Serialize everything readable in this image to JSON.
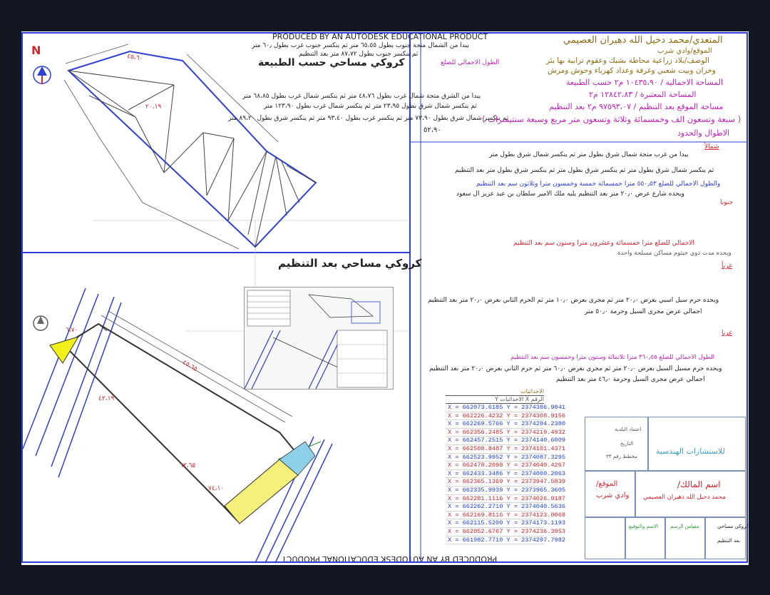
{
  "watermark": {
    "top": "PRODUCED BY AN AUTODESK EDUCATIONAL PRODUCT",
    "bottom": "PRODUCED BY AN AUTODESK EDUCATIONAL PRODUCT"
  },
  "north": {
    "label": "N"
  },
  "plan_top": {
    "title": "كروكي مساحي حسب الطبيعة",
    "north_dims": [
      "يبدا من الشمال متجة جنوب بطول ٦٥،٥٥ متر ثم ينكسر جنوب غرب بطول ٦٠٫ متر",
      "ثم ينكسر جنوب بطول ٨٧،٧٢ متر بعد التنظيم",
      "الطول الاجمالي للضلع"
    ],
    "east_dims": [
      "يبدا من الشرق متجة شمال غرب بطول ٤٨،٧٦ متر ثم ينكسر شمال غرب بطول ٦٨،٨٥ متر",
      "ثم ينكسر شمال شرق بطول ٢٣،٩٥ متر ثم ينكسر شمال غرب بطول ١٢٣،٩٠ متر",
      "ثم ينكسر شمال شرق بطول ٧٣،٩٠ متر ثم ينكسر غرب بطول ٩٣،٤٠ متر ثم ينكسر شرق بطول ٨٩،٢٠ متر"
    ],
    "dim_last": "٥٢،٩٠",
    "edge_labels": [
      "٤٥،٦٠",
      "٢٠،١٩"
    ]
  },
  "plan_bottom": {
    "title": "كروكي مساحي بعد التنظيم",
    "labels": [
      "٦،٧٠",
      "٤٥،٦٥",
      "٦٢،٦٥",
      "٧٤،١٠",
      "٤٢،١٩"
    ]
  },
  "right_panel": {
    "owner": "المتعدي/محمد دخيل الله دهيران العصيمي",
    "site": "الموقع/وادي شرب",
    "desc": "الوصف/بلاد زراعية محاطة بشبك وعقوم ترابية بها بئر",
    "desc2": "وخزان وبيت شعبي وغرفة وعداد كهرباء وحوش ومرش",
    "area_total": "المساحة الاجمالية / ١٠٤٣٥،٩٠ م٢ حسب الطبيعة",
    "area_after": "المساحة المعتبرة / ١٢٨٤٢،٨٣ م٢",
    "area_site": "مساحة الموقع بعد التنظيم / ٩٧٥٩٣،٠٧ م٢ بعد التنظيم",
    "area_words": "( سبعة وتسعون الف وخمسمائة وثلاثة وتسعون متر مربع وسبعة سنتيمترات )",
    "lengths_heading": "الاطوال والحدود",
    "north_h": "شمالاً",
    "north_l1": "يبدا من غرب متجة شمال شرق بطول متر ثم ينكسر شمال شرق بطول متر",
    "north_l2": "ثم ينكسر شمال شرق بطول متر ثم ينكسر شرق بطول متر ثم ينكسر شرق بطول متر بعد التنظيم",
    "north_l3": "والطول الاجمالي للضلع ٥٥٠٫٥٣ مترا خمسمائة خمسة وخمسون مترا وثلاثون سم بعد التنظيم",
    "north_l4": "ويحده شارع عرض ٢٠٫٠ متر بعد التنظيم يليه ملك الامير سلطان بن عبد عزيز ال سعود",
    "north_l5": "جنوبا",
    "south_l1": "الاجمالي للضلع مترا خمسمائة وعشرون مترا وستون سم بعد التنظيم",
    "south_l2": "ويحده مدت ذوي خيثوم مساكن مسلحة واحدة",
    "west_h": "غرباً",
    "west_l1": "ويحده حرم سيل اسبي بعرض ٢٠٫٠ متر ثم مجرى بعرض ١٠٫٠ متر ثم الحرم الثاني بعرض ٢٠٫٠ متر بعد التنظيم",
    "west_l2": "اجمالي عرض مجرى السيل وحرمة ٥٠٫٠ متر",
    "east_h": "غربا",
    "east_l1": "الطول الاجمالي للضلع ٣٦٠٫٥٥ مترا ثلاثمائة وستون مترا وخمسون سم بعد التنظيم",
    "east_l2": "ويحده حرم مسيل السيل بعرض ٢٠٫٠ متر ثم مجرى بعرض ٦٠٫٠ متر ثم حرم الثاني بعرض ٢٠٫٠ متر بعد التنظيم",
    "east_l3": "اجمالي عرض مجرى السيل وحرمة ٤٦٫٠ متر بعد التنظيم"
  },
  "coords_table": {
    "title": "الاحداثيات",
    "header": "الرقم  X  الاحداثيات  Y",
    "rows": [
      "X = 662073.6185 Y = 2374386.9841",
      "X = 662226.4232 Y = 2374308.9156",
      "X = 662269.5766 Y = 2374294.2380",
      "X = 662356.2485 Y = 2374219.4932",
      "X = 662457.2515 Y = 2374140.6009",
      "X = 662508.8487 Y = 2374101.4371",
      "X = 662523.9952 Y = 2374087.3295",
      "X = 662478.2098 Y = 2374040.4267",
      "X = 662433.3486 Y = 2374000.2063",
      "X = 662365.1369 Y = 2373947.5839",
      "X = 662335.9939 Y = 2373965.3605",
      "X = 662281.1116 Y = 2374026.9187",
      "X = 662262.2710 Y = 2374040.5636",
      "X = 662169.8116 Y = 2374123.0068",
      "X = 662115.5200 Y = 2374173.1193",
      "X = 662052.6767 Y = 2374236.3953",
      "X = 661982.7710 Y = 2374297.7982"
    ],
    "row_colors": [
      "#1a3fd4",
      "#c4262a"
    ]
  },
  "title_block": {
    "office": "للاستشارات الهندسية",
    "owner_label": "اسم المالك/",
    "owner_name": "محمد دخيل الله دهيران العصيمي",
    "site_label": "الموقع/",
    "site_name": "وادي شرب",
    "approval": "اعتماد البلدية",
    "date_label": "التاريخ",
    "plan_no": "مخطط رقم ٣٣",
    "scale": "مقياس الرسم",
    "drawn_by": "الاسم والتوقيع",
    "sketch_title": "كروكي مساحي",
    "sketch_sub": "بعد التنظيم"
  },
  "colors": {
    "blue_frame": "#2d3fd6",
    "red": "#d4262c",
    "magenta": "#c21fb8",
    "green": "#2a9a32",
    "olive": "#8f6c12",
    "yellow_fill": "#f5f07a"
  }
}
